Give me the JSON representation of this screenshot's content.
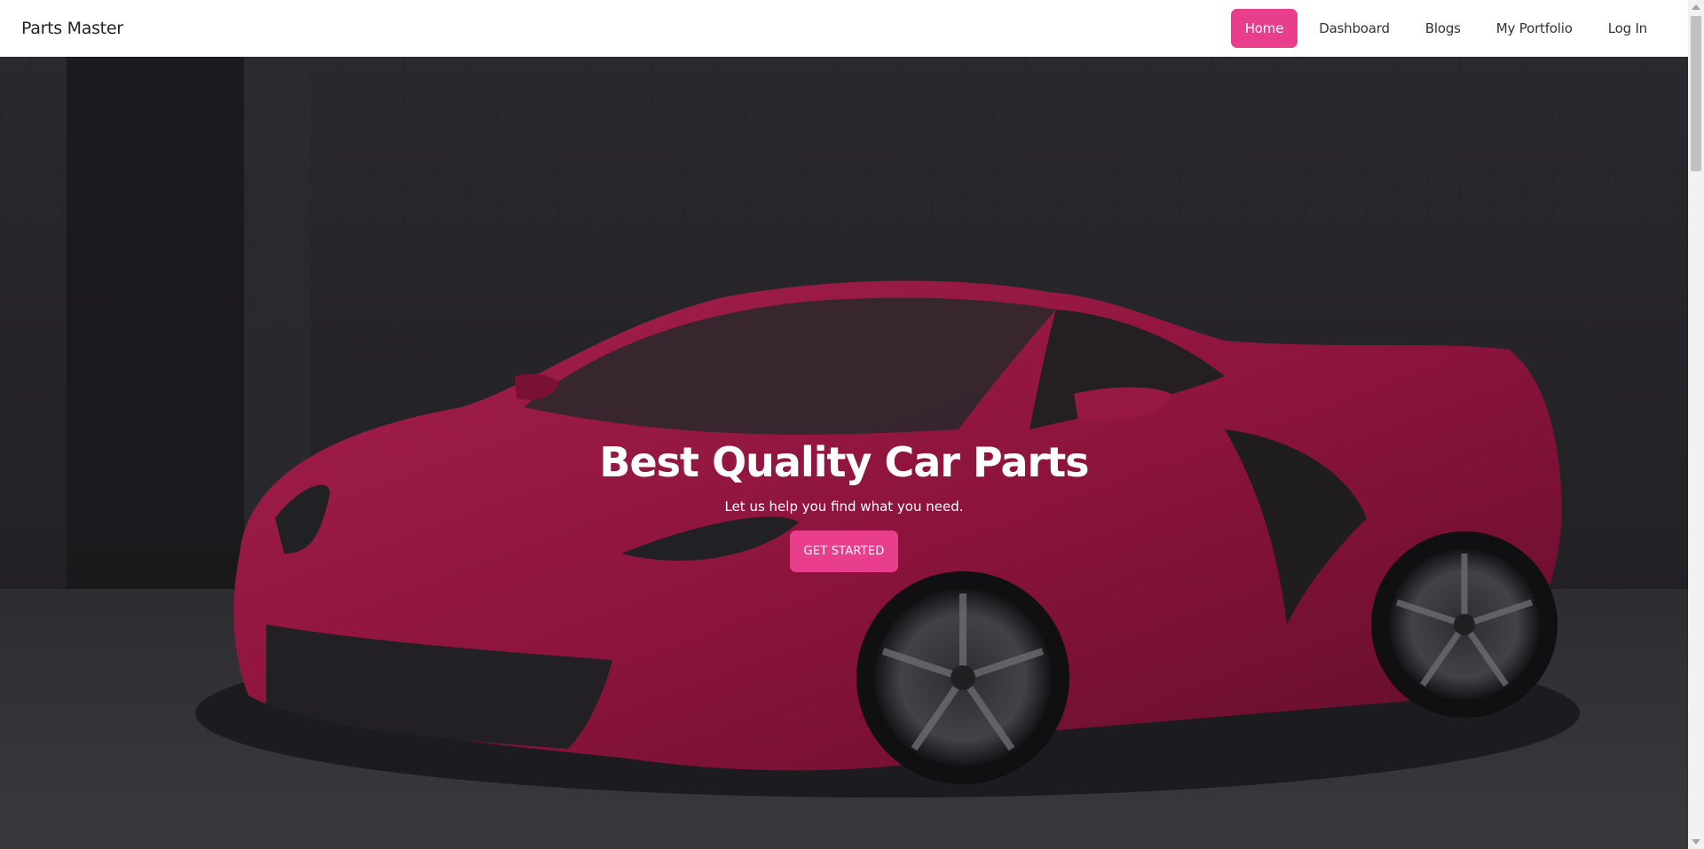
{
  "nav": {
    "brand": "Parts Master",
    "links": [
      {
        "label": "Home",
        "active": true
      },
      {
        "label": "Dashboard",
        "active": false
      },
      {
        "label": "Blogs",
        "active": false
      },
      {
        "label": "My Portfolio",
        "active": false
      },
      {
        "label": "Log In",
        "active": false
      }
    ]
  },
  "hero": {
    "title": "Best Quality Car Parts",
    "subtitle": "Let us help you find what you need.",
    "cta_label": "GET STARTED"
  },
  "colors": {
    "accent": "#e83e8c",
    "car_body": "#b0174a",
    "background_dark": "#2a2a30"
  },
  "icons": {
    "hero_image": "red-sports-car-image"
  }
}
